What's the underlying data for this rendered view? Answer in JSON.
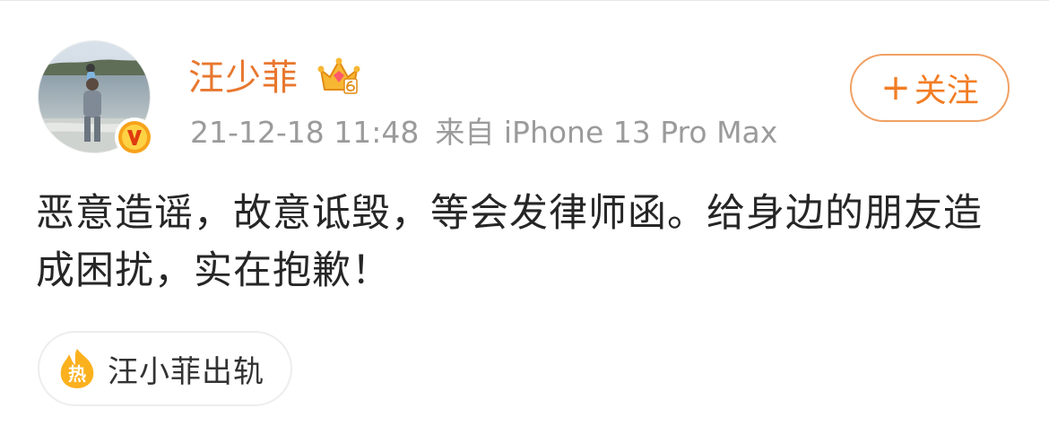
{
  "post": {
    "username": "汪少菲",
    "timestamp": "21-12-18 11:48",
    "source": "来自 iPhone 13 Pro Max",
    "content": "恶意造谣，故意诋毁，等会发律师函。给身边的朋友造成困扰，实在抱歉！"
  },
  "follow_button": {
    "plus": "+",
    "label": "关注"
  },
  "topic": {
    "label": "汪小菲出轨",
    "icon_char": "热"
  },
  "icons": {
    "avatar": "avatar-photo",
    "verified": "verified-v-badge",
    "vip": "crown-icon",
    "hot": "hot-icon"
  },
  "colors": {
    "accent": "#f27d24",
    "username": "#e8772e",
    "meta": "#9b9b9b",
    "text": "#262626"
  }
}
